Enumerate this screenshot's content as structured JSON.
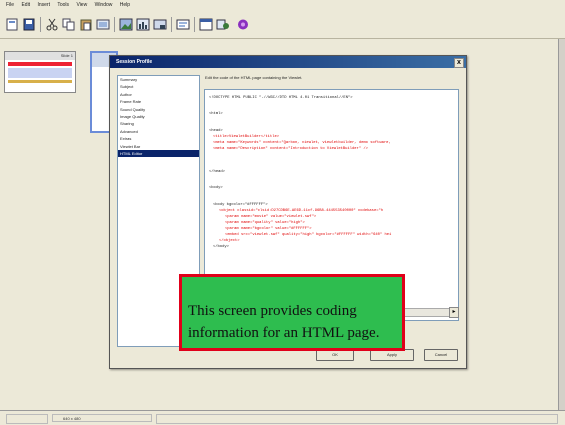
{
  "menubar": {
    "items": [
      "File",
      "Edit",
      "Insert",
      "Tools",
      "View",
      "Window",
      "Help"
    ]
  },
  "toolbar": {
    "icons": [
      "new-icon",
      "save-icon",
      "cut-icon",
      "copy-icon",
      "paste-icon",
      "slide-icon",
      "image-icon",
      "chart-icon",
      "export-icon",
      "preview-icon",
      "html-icon",
      "publish-icon"
    ]
  },
  "slides": {
    "slide1_label": "Slide 1"
  },
  "dialog": {
    "title": "Session Profile",
    "close_label": "x",
    "instructions": "Edit the code of the HTML page containing the Viewlet.",
    "sidebar_items": [
      "Summary",
      "Subject",
      "Author",
      "Frame Rate",
      "Sound Quality",
      "Image Quality",
      "Sharing",
      "Advanced",
      "Extras",
      "Viewlet Bar",
      "HTML Editor"
    ],
    "selected_index": 10,
    "code_lines": [
      {
        "text": "<!DOCTYPE HTML PUBLIC \"-//W3C//DTD HTML 4.01 Transitional//EN\">",
        "cls": "c-plain"
      },
      {
        "text": "<html>",
        "cls": "c-plain"
      },
      {
        "text": "<head>",
        "cls": "c-plain"
      },
      {
        "text": "<title>ViewletBuilder</title>",
        "cls": "c-attr"
      },
      {
        "text": "<meta name=\"Keywords\" content=\"Qarbon, viewlet, viewletbuilder, demo software,",
        "cls": "c-attr"
      },
      {
        "text": "<meta name=\"Description\" content=\"Introduction to ViewletBuilder\" />",
        "cls": "c-attr"
      },
      {
        "text": "</head>",
        "cls": "c-plain"
      },
      {
        "text": "<body>",
        "cls": "c-plain"
      },
      {
        "text": "<body bgcolor=\"#FFFFFF\">",
        "cls": "c-plain"
      },
      {
        "text": "<object classid=\"clsid:D27CDB6E-AE6D-11cf-96B8-444553540000\" codebase=\"h",
        "cls": "c-attr"
      },
      {
        "text": "<param name=\"movie\" value=\"viewlet.swf\">",
        "cls": "c-attr"
      },
      {
        "text": "<param name=\"quality\" value=\"high\">",
        "cls": "c-attr"
      },
      {
        "text": "<param name=\"bgcolor\" value=\"#FFFFFF\">",
        "cls": "c-attr"
      },
      {
        "text": "<embed src=\"viewlet.swf\" quality=\"high\" bgcolor=\"#FFFFFF\" width=\"640\" hei",
        "cls": "c-attr"
      },
      {
        "text": "</object>",
        "cls": "c-attr"
      },
      {
        "text": "</body>",
        "cls": "c-plain"
      }
    ],
    "buttons": {
      "ok": "OK",
      "apply": "Apply",
      "cancel": "Cancel"
    }
  },
  "caption": {
    "text": "This screen provides coding information for an HTML page."
  },
  "statusbar": {
    "resolution": "640 x 480"
  }
}
